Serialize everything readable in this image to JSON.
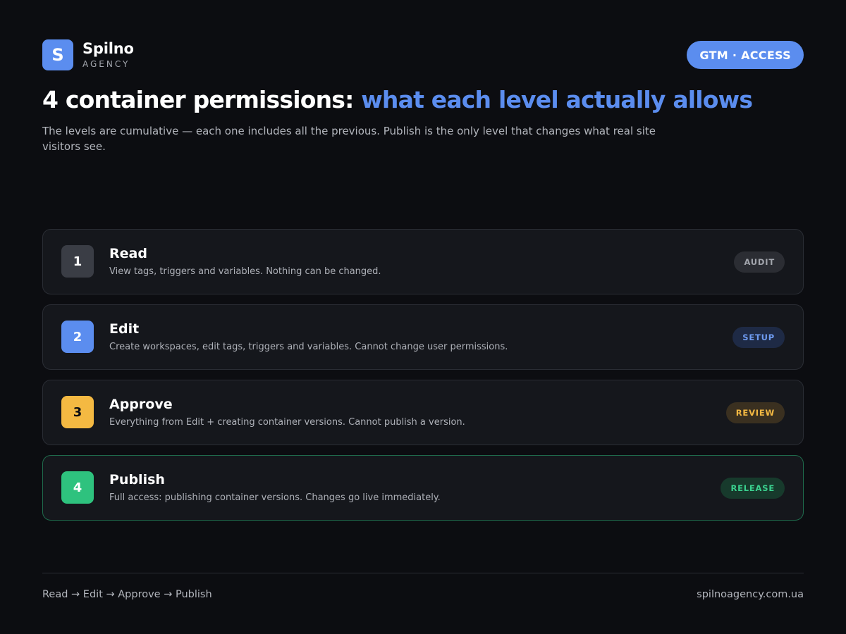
{
  "brand": {
    "logo_letter": "S",
    "name": "Spilno",
    "sub": "AGENCY"
  },
  "tag": "GTM · ACCESS",
  "title": {
    "main": "4 container permissions: ",
    "accent": "what each level actually allows"
  },
  "subtitle": "The levels are cumulative — each one includes all the previous. Publish is the only level that changes what real site visitors see.",
  "levels": [
    {
      "num": "1",
      "title": "Read",
      "desc": "View tags, triggers and variables. Nothing can be changed.",
      "badge": "AUDIT",
      "colors": {
        "num_bg": "#3a3d45",
        "num_fg": "#ffffff",
        "badge_bg": "#2b2d33",
        "badge_fg": "#a3a6ad"
      }
    },
    {
      "num": "2",
      "title": "Edit",
      "desc": "Create workspaces, edit tags, triggers and variables. Cannot change user permissions.",
      "badge": "SETUP",
      "colors": {
        "num_bg": "#5b8def",
        "num_fg": "#ffffff",
        "badge_bg": "#1e2a45",
        "badge_fg": "#6f9cf2"
      }
    },
    {
      "num": "3",
      "title": "Approve",
      "desc": "Everything from Edit + creating container versions. Cannot publish a version.",
      "badge": "REVIEW",
      "colors": {
        "num_bg": "#f4b942",
        "num_fg": "#0c0d11",
        "badge_bg": "#3a3020",
        "badge_fg": "#f4b942"
      }
    },
    {
      "num": "4",
      "title": "Publish",
      "desc": "Full access: publishing container versions. Changes go live immediately.",
      "badge": "RELEASE",
      "colors": {
        "num_bg": "#2ec27e",
        "num_fg": "#ffffff",
        "badge_bg": "#173a2c",
        "badge_fg": "#3ad08e"
      }
    }
  ],
  "footer": {
    "flow": "Read → Edit → Approve → Publish",
    "site": "spilnoagency.com.ua"
  }
}
